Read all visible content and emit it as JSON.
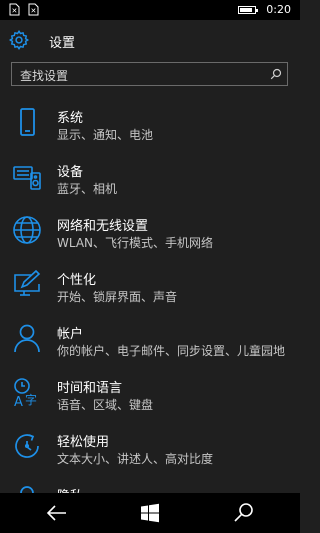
{
  "status_bar": {
    "time": "0:20",
    "battery_level": 0.85
  },
  "header": {
    "title": "设置",
    "icon": "gear-icon"
  },
  "search": {
    "placeholder": "查找设置",
    "icon": "search-icon"
  },
  "accent_color": "#1e90e8",
  "categories": [
    {
      "title": "系统",
      "subtitle": "显示、通知、电池",
      "icon": "phone-icon"
    },
    {
      "title": "设备",
      "subtitle": "蓝牙、相机",
      "icon": "keyboard-speaker-icon"
    },
    {
      "title": "网络和无线设置",
      "subtitle": "WLAN、飞行模式、手机网络",
      "icon": "globe-icon"
    },
    {
      "title": "个性化",
      "subtitle": "开始、锁屏界面、声音",
      "icon": "monitor-pen-icon"
    },
    {
      "title": "帐户",
      "subtitle": "你的帐户、电子邮件、同步设置、儿童园地",
      "icon": "person-icon"
    },
    {
      "title": "时间和语言",
      "subtitle": "语音、区域、键盘",
      "icon": "time-language-icon"
    },
    {
      "title": "轻松使用",
      "subtitle": "文本大小、讲述人、高对比度",
      "icon": "ease-of-access-icon"
    },
    {
      "title": "隐私",
      "subtitle": "",
      "icon": "lock-icon"
    }
  ],
  "nav": {
    "back": "back-arrow-icon",
    "start": "windows-logo-icon",
    "search": "search-icon"
  }
}
